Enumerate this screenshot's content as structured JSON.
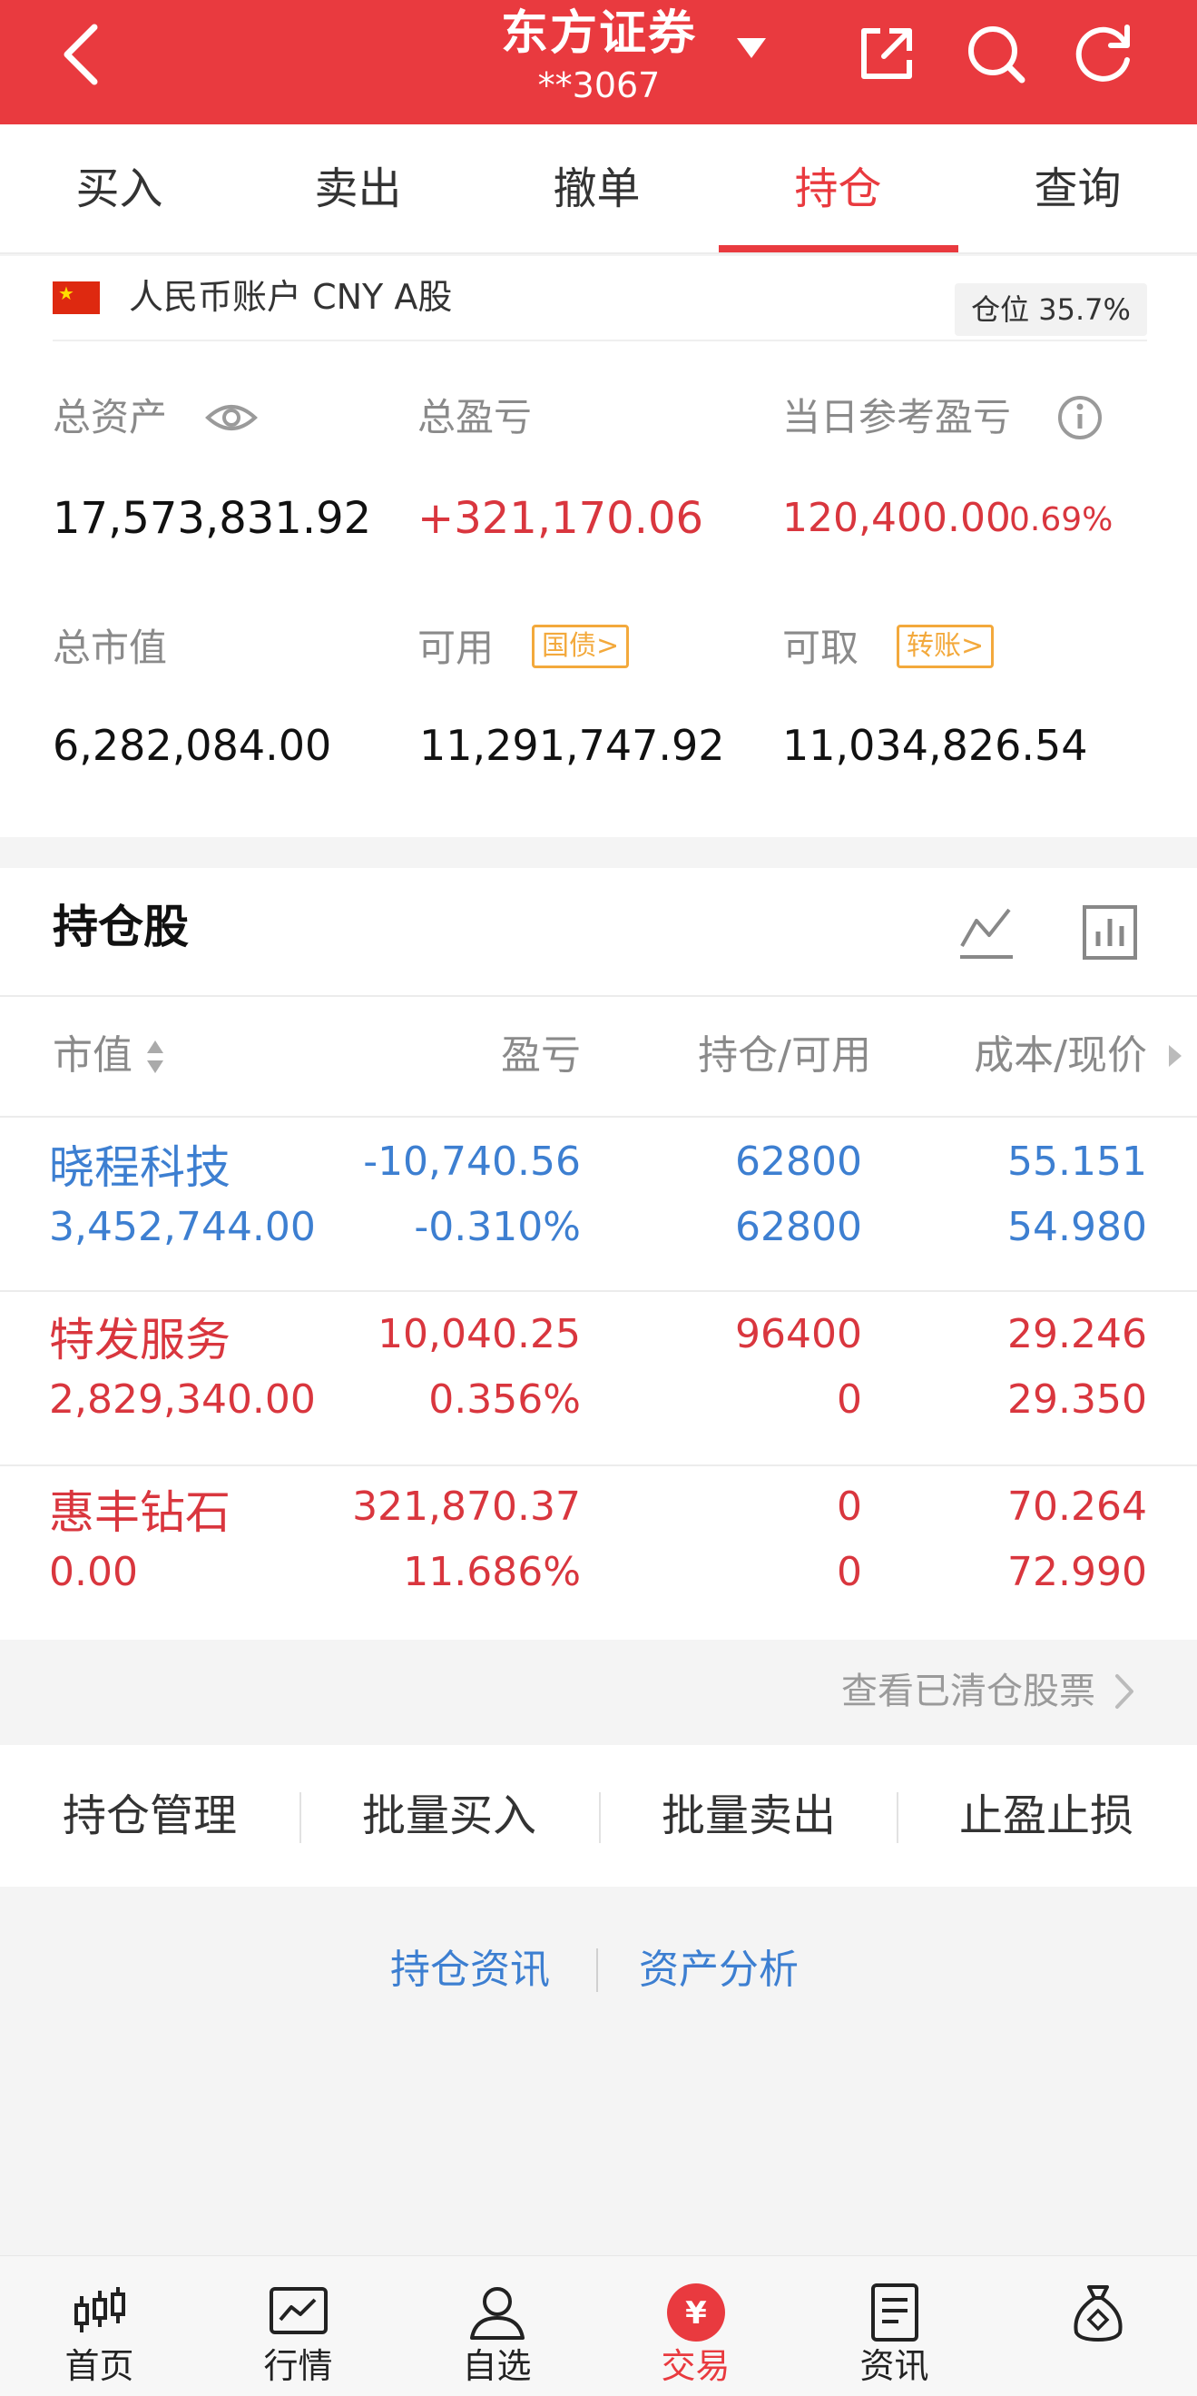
{
  "header": {
    "title": "东方证券",
    "account_masked": "**3067",
    "bg_color": "#e93a3f"
  },
  "tabs": [
    {
      "label": "买入"
    },
    {
      "label": "卖出"
    },
    {
      "label": "撤单"
    },
    {
      "label": "持仓",
      "active": true
    },
    {
      "label": "查询"
    }
  ],
  "account": {
    "label": "人民币账户 CNY A股",
    "position_ratio": "仓位 35.7%",
    "total_assets_label": "总资产",
    "total_assets": "17,573,831.92",
    "total_pnl_label": "总盈亏",
    "total_pnl": "+321,170.06",
    "daily_pnl_label": "当日参考盈亏",
    "daily_pnl": "120,400.00",
    "daily_pnl_pct": "0.69%",
    "market_value_label": "总市值",
    "market_value": "6,282,084.00",
    "available_label": "可用",
    "available_tag": "国债>",
    "available": "11,291,747.92",
    "withdrawable_label": "可取",
    "withdrawable_tag": "转账>",
    "withdrawable": "11,034,826.54"
  },
  "holdings": {
    "title": "持仓股",
    "columns": [
      "市值",
      "盈亏",
      "持仓/可用",
      "成本/现价"
    ],
    "rows": [
      {
        "name": "晓程科技",
        "market_value": "3,452,744.00",
        "pnl": "-10,740.56",
        "pnl_pct": "-0.310%",
        "position": "62800",
        "available": "62800",
        "cost": "55.151",
        "price": "54.980",
        "color": "blue"
      },
      {
        "name": "特发服务",
        "market_value": "2,829,340.00",
        "pnl": "10,040.25",
        "pnl_pct": "0.356%",
        "position": "96400",
        "available": "0",
        "cost": "29.246",
        "price": "29.350",
        "color": "red"
      },
      {
        "name": "惠丰钻石",
        "market_value": "0.00",
        "pnl": "321,870.37",
        "pnl_pct": "11.686%",
        "position": "0",
        "available": "0",
        "cost": "70.264",
        "price": "72.990",
        "color": "red"
      }
    ],
    "cleared_link": "查看已清仓股票"
  },
  "actions": [
    "持仓管理",
    "批量买入",
    "批量卖出",
    "止盈止损"
  ],
  "links": [
    "持仓资讯",
    "资产分析"
  ],
  "bottom_nav": [
    {
      "label": "首页",
      "icon": "candlestick-icon"
    },
    {
      "label": "行情",
      "icon": "chart-icon"
    },
    {
      "label": "自选",
      "icon": "user-icon"
    },
    {
      "label": "交易",
      "icon": "yen-icon",
      "active": true
    },
    {
      "label": "资讯",
      "icon": "document-icon"
    },
    {
      "label": "",
      "icon": "money-bag-icon"
    }
  ]
}
